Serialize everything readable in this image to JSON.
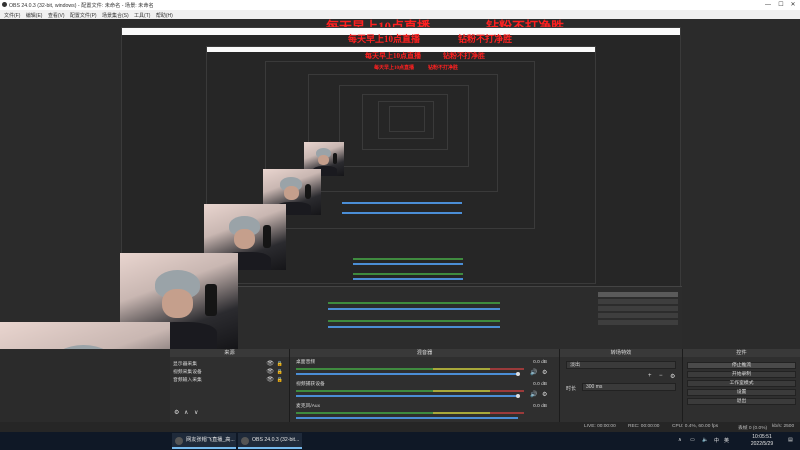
{
  "window": {
    "title": "OBS 24.0.3 (32-bit, windows) - 配置文件: 未命名 - 场景: 未命名",
    "minimize": "—",
    "maximize": "☐",
    "close": "✕"
  },
  "menu": [
    "文件(F)",
    "编辑(E)",
    "查看(V)",
    "配置文件(P)",
    "场景集合(S)",
    "工具(T)",
    "帮助(H)"
  ],
  "overlay": {
    "line1": "每天早上10点直播",
    "line2": "钻粉不打净胜"
  },
  "docks": {
    "sources": {
      "title": "来源",
      "items": [
        "显示器采集",
        "视频采集设备",
        "音频输入采集"
      ],
      "add": "+",
      "remove": "−",
      "settings": "⚙",
      "up": "∧",
      "down": "∨"
    },
    "mixer": {
      "title": "混音器",
      "channels": [
        {
          "name": "桌面音频",
          "db": "0.0 dB"
        },
        {
          "name": "视频捕获设备",
          "db": "0.0 dB"
        },
        {
          "name": "麦克风/Aux",
          "db": "0.0 dB"
        }
      ]
    },
    "transitions": {
      "title": "转场特效",
      "type": "淡出",
      "duration_label": "时长",
      "duration_value": "300 ms",
      "add": "+",
      "remove": "−",
      "settings": "⚙"
    },
    "controls": {
      "title": "控件",
      "buttons": [
        "停止推流",
        "开始录制",
        "工作室模式",
        "设置",
        "退出"
      ]
    }
  },
  "status": {
    "live": "LIVE: 00:00:00",
    "rec": "REC: 00:00:00",
    "cpu": "CPU: 0.4%, 60.00 fps",
    "dropped": "丢帧 0 (0.0%)",
    "bitrate": "kb/s: 2500"
  },
  "taskbar": {
    "tasks": [
      "网友张帽飞直播_高...",
      "OBS 24.0.3 (32-bit..."
    ],
    "time": "10:05:51",
    "date": "2022/5/29",
    "lang": "英",
    "ime": "中"
  }
}
